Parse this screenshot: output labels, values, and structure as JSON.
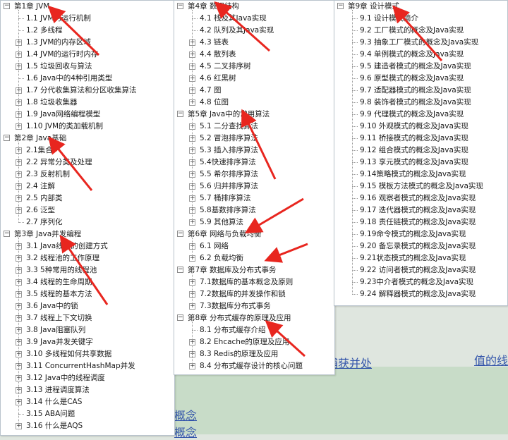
{
  "background": {
    "links": [
      "捕获并处",
      "值的线",
      "概念",
      "概念"
    ]
  },
  "panels": [
    {
      "chapters": [
        {
          "label": "第1章 JVM",
          "items": [
            {
              "label": "1.1 JVM的运行机制",
              "expandable": false
            },
            {
              "label": "1.2 多线程",
              "expandable": false
            },
            {
              "label": "1.3 JVM的内存区域",
              "expandable": true
            },
            {
              "label": "1.4 JVM的运行时内存",
              "expandable": true
            },
            {
              "label": "1.5 垃圾回收与算法",
              "expandable": true
            },
            {
              "label": "1.6 Java中的4种引用类型",
              "expandable": false
            },
            {
              "label": "1.7 分代收集算法和分区收集算法",
              "expandable": true
            },
            {
              "label": "1.8 垃圾收集器",
              "expandable": true
            },
            {
              "label": "1.9 Java网络编程模型",
              "expandable": true
            },
            {
              "label": "1.10 JVM的类加载机制",
              "expandable": true
            }
          ]
        },
        {
          "label": "第2章 Java基础",
          "items": [
            {
              "label": "2.1集合",
              "expandable": true
            },
            {
              "label": "2.2 异常分类及处理",
              "expandable": true
            },
            {
              "label": "2.3 反射机制",
              "expandable": true
            },
            {
              "label": "2.4 注解",
              "expandable": true
            },
            {
              "label": "2.5 内部类",
              "expandable": true
            },
            {
              "label": "2.6 泛型",
              "expandable": true
            },
            {
              "label": "2.7 序列化",
              "expandable": false
            }
          ]
        },
        {
          "label": "第3章 Java并发编程",
          "items": [
            {
              "label": "3.1 Java线程的创建方式",
              "expandable": true
            },
            {
              "label": "3.2 线程池的工作原理",
              "expandable": true
            },
            {
              "label": "3.3 5种常用的线程池",
              "expandable": true
            },
            {
              "label": "3.4 线程的生命周期",
              "expandable": true
            },
            {
              "label": "3.5 线程的基本方法",
              "expandable": true
            },
            {
              "label": "3.6 Java中的锁",
              "expandable": true
            },
            {
              "label": "3.7 线程上下文切换",
              "expandable": true
            },
            {
              "label": "3.8 Java阻塞队列",
              "expandable": true
            },
            {
              "label": "3.9 Java并发关键字",
              "expandable": true
            },
            {
              "label": "3.10 多线程如何共享数据",
              "expandable": true
            },
            {
              "label": "3.11 ConcurrentHashMap并发",
              "expandable": true
            },
            {
              "label": "3.12 Java中的线程调度",
              "expandable": true
            },
            {
              "label": "3.13 进程调度算法",
              "expandable": true
            },
            {
              "label": "3.14 什么是CAS",
              "expandable": true
            },
            {
              "label": "3.15 ABA问题",
              "expandable": false
            },
            {
              "label": "3.16 什么是AQS",
              "expandable": true
            }
          ]
        }
      ]
    },
    {
      "chapters": [
        {
          "label": "第4章 数据结构",
          "items": [
            {
              "label": "4.1 栈及其Java实现",
              "expandable": false
            },
            {
              "label": "4.2 队列及其Java实现",
              "expandable": false
            },
            {
              "label": "4.3 链表",
              "expandable": true
            },
            {
              "label": "4.4 散列表",
              "expandable": true
            },
            {
              "label": "4.5 二叉排序树",
              "expandable": true
            },
            {
              "label": "4.6 红黑树",
              "expandable": true
            },
            {
              "label": "4.7 图",
              "expandable": true
            },
            {
              "label": "4.8 位图",
              "expandable": true
            }
          ]
        },
        {
          "label": "第5章 Java中的常用算法",
          "items": [
            {
              "label": "5.1 二分查找算法",
              "expandable": true
            },
            {
              "label": "5.2 冒泡排序算法",
              "expandable": true
            },
            {
              "label": "5.3 插入排序算法",
              "expandable": true
            },
            {
              "label": "5.4快速排序算法",
              "expandable": true
            },
            {
              "label": "5.5 希尔排序算法",
              "expandable": true
            },
            {
              "label": "5.6 归并排序算法",
              "expandable": true
            },
            {
              "label": "5.7 桶排序算法",
              "expandable": true
            },
            {
              "label": "5.8基数排序算法",
              "expandable": true
            },
            {
              "label": "5.9 其他算法",
              "expandable": true
            }
          ]
        },
        {
          "label": "第6章 网络与负载均衡",
          "items": [
            {
              "label": "6.1 网络",
              "expandable": true
            },
            {
              "label": "6.2 负载均衡",
              "expandable": true
            }
          ]
        },
        {
          "label": "第7章 数据库及分布式事务",
          "items": [
            {
              "label": "7.1数据库的基本概念及原则",
              "expandable": true
            },
            {
              "label": "7.2数据库的并发操作和锁",
              "expandable": true
            },
            {
              "label": "7.3数据库分布式事务",
              "expandable": true
            }
          ]
        },
        {
          "label": "第8章 分布式缓存的原理及应用",
          "items": [
            {
              "label": "8.1 分布式缓存介绍",
              "expandable": false
            },
            {
              "label": "8.2 Ehcache的原理及应用",
              "expandable": true
            },
            {
              "label": "8.3 Redis的原理及应用",
              "expandable": true
            },
            {
              "label": "8.4 分布式缓存设计的核心问题",
              "expandable": true
            }
          ]
        }
      ]
    },
    {
      "chapters": [
        {
          "label": "第9章 设计模式",
          "items": [
            {
              "label": "9.1 设计模式简介",
              "expandable": false
            },
            {
              "label": "9.2 工厂模式的概念及Java实现",
              "expandable": false
            },
            {
              "label": "9.3 抽象工厂模式的概念及Java实现",
              "expandable": false
            },
            {
              "label": "9.4 单例模式的概念及Java实现",
              "expandable": false
            },
            {
              "label": "9.5 建造者模式的概念及Java实现",
              "expandable": false
            },
            {
              "label": "9.6 原型模式的概念及Java实现",
              "expandable": false
            },
            {
              "label": "9.7 适配器模式的概念及Java实现",
              "expandable": false
            },
            {
              "label": "9.8 装饰者模式的概念及Java实现",
              "expandable": false
            },
            {
              "label": "9.9 代理模式的概念及Java实现",
              "expandable": false
            },
            {
              "label": "9.10 外观模式的概念及Java实现",
              "expandable": false
            },
            {
              "label": "9.11 桥接模式的概念及Java实现",
              "expandable": false
            },
            {
              "label": "9.12 组合模式的概念及Java实现",
              "expandable": false
            },
            {
              "label": "9.13 享元模式的概念及Java实现",
              "expandable": false
            },
            {
              "label": "9.14策略模式的概念及Java实现",
              "expandable": false
            },
            {
              "label": "9.15 模板方法模式的概念及Java实现",
              "expandable": false
            },
            {
              "label": "9.16 观察者模式的概念及Java实现",
              "expandable": false
            },
            {
              "label": "9.17 迭代器模式的概念及Java实现",
              "expandable": false
            },
            {
              "label": "9.18 责任链模式的概念及Java实现",
              "expandable": false
            },
            {
              "label": "9.19命令模式的概念及Java实现",
              "expandable": false
            },
            {
              "label": "9.20 备忘录模式的概念及Java实现",
              "expandable": false
            },
            {
              "label": "9.21状态模式的概念及Java实现",
              "expandable": false
            },
            {
              "label": "9.22 访问者模式的概念及Java实现",
              "expandable": false
            },
            {
              "label": "9.23中介者模式的概念及Java实现",
              "expandable": false
            },
            {
              "label": "9.24 解释器模式的概念及Java实现",
              "expandable": false
            }
          ]
        }
      ]
    }
  ],
  "colors": {
    "arrow": "#e8261f",
    "panel_border": "#b9c4cc",
    "link": "#3355aa"
  }
}
